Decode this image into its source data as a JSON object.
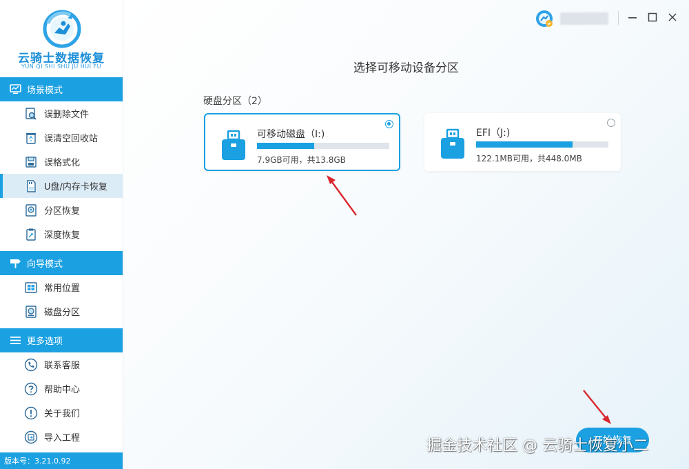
{
  "app": {
    "name": "云骑士数据恢复",
    "name_pinyin": "YUN QI SHI SHU JU HUI FU",
    "version": "版本号：3.21.0.92"
  },
  "sidebar": {
    "sections": [
      {
        "title": "场景模式",
        "icon": "monitor-icon",
        "items": [
          {
            "label": "误删除文件",
            "icon": "file-search-icon"
          },
          {
            "label": "误清空回收站",
            "icon": "recycle-bin-icon"
          },
          {
            "label": "误格式化",
            "icon": "format-icon"
          },
          {
            "label": "U盘/内存卡恢复",
            "icon": "sd-card-icon",
            "active": true
          },
          {
            "label": "分区恢复",
            "icon": "partition-icon"
          },
          {
            "label": "深度恢复",
            "icon": "deep-scan-icon"
          }
        ]
      },
      {
        "title": "向导模式",
        "icon": "signpost-icon",
        "items": [
          {
            "label": "常用位置",
            "icon": "windows-icon"
          },
          {
            "label": "磁盘分区",
            "icon": "disk-icon"
          }
        ]
      },
      {
        "title": "更多选项",
        "icon": "menu-icon",
        "items": [
          {
            "label": "联系客服",
            "icon": "phone-icon"
          },
          {
            "label": "帮助中心",
            "icon": "help-icon"
          },
          {
            "label": "关于我们",
            "icon": "info-icon"
          },
          {
            "label": "导入工程",
            "icon": "import-icon"
          }
        ]
      }
    ]
  },
  "main": {
    "title": "选择可移动设备分区",
    "group_label": "硬盘分区（2）",
    "partitions": [
      {
        "name": "可移动磁盘（I:)",
        "info": "7.9GB可用，共13.8GB",
        "used_fraction": 0.43,
        "selected": true,
        "icon": "usb-drive-icon"
      },
      {
        "name": "EFI（J:)",
        "info": "122.1MB可用，共448.0MB",
        "used_fraction": 0.73,
        "selected": false,
        "icon": "usb-drive-icon"
      }
    ],
    "start_button": "开始恢复"
  },
  "watermark": "掘金技术社区 @ 云骑士恢复小二",
  "colors": {
    "accent": "#1ba0e2",
    "active_item_bg": "#dcecf7",
    "bar_track": "#dfe5ea",
    "annotation_arrow": "#d9282f"
  }
}
